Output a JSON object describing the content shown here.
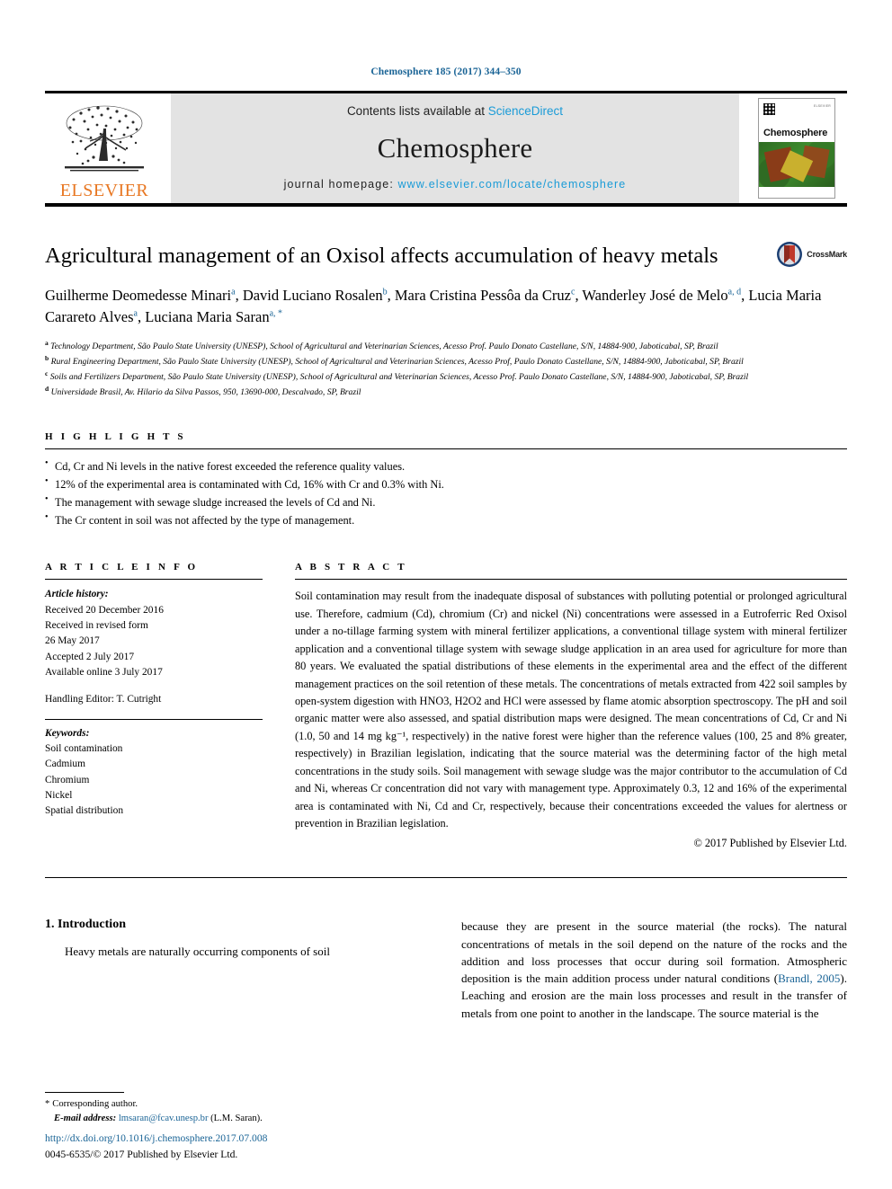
{
  "running_head": "Chemosphere 185 (2017) 344–350",
  "masthead": {
    "publisher_name": "ELSEVIER",
    "contents_prefix": "Contents lists available at ",
    "contents_link": "ScienceDirect",
    "journal_name": "Chemosphere",
    "homepage_prefix": "journal homepage: ",
    "homepage_url": "www.elsevier.com/locate/chemosphere",
    "cover_title": "Chemosphere",
    "cover_publisher": "ELSEVIER"
  },
  "article": {
    "title": "Agricultural management of an Oxisol affects accumulation of heavy metals",
    "crossmark_label": "CrossMark",
    "authors_line1": "Guilherme Deomedesse Minari",
    "authors": "Guilherme Deomedesse Minari a, David Luciano Rosalen b, Mara Cristina Pessôa da Cruz c, Wanderley José de Melo a, d, Lucia Maria Carareto Alves a, Luciana Maria Saran a, *",
    "affiliations": [
      "Technology Department, São Paulo State University (UNESP), School of Agricultural and Veterinarian Sciences, Acesso Prof. Paulo Donato Castellane, S/N, 14884-900, Jaboticabal, SP, Brazil",
      "Rural Engineering Department, São Paulo State University (UNESP), School of Agricultural and Veterinarian Sciences, Acesso Prof, Paulo Donato Castellane, S/N, 14884-900, Jaboticabal, SP, Brazil",
      "Soils and Fertilizers Department, São Paulo State University (UNESP), School of Agricultural and Veterinarian Sciences, Acesso Prof. Paulo Donato Castellane, S/N, 14884-900, Jaboticabal, SP, Brazil",
      "Universidade Brasil, Av. Hilario da Silva Passos, 950, 13690-000, Descalvado, SP, Brazil"
    ],
    "affiliation_marks": [
      "a",
      "b",
      "c",
      "d"
    ]
  },
  "highlights": {
    "heading": "H I G H L I G H T S",
    "items": [
      "Cd, Cr and Ni levels in the native forest exceeded the reference quality values.",
      "12% of the experimental area is contaminated with Cd, 16% with Cr and 0.3% with Ni.",
      "The management with sewage sludge increased the levels of Cd and Ni.",
      "The Cr content in soil was not affected by the type of management."
    ]
  },
  "article_info": {
    "heading": "A R T I C L E   I N F O",
    "history_label": "Article history:",
    "history": [
      "Received 20 December 2016",
      "Received in revised form",
      "26 May 2017",
      "Accepted 2 July 2017",
      "Available online 3 July 2017"
    ],
    "handling_editor": "Handling Editor: T. Cutright",
    "keywords_label": "Keywords:",
    "keywords": [
      "Soil contamination",
      "Cadmium",
      "Chromium",
      "Nickel",
      "Spatial distribution"
    ]
  },
  "abstract": {
    "heading": "A B S T R A C T",
    "text": "Soil contamination may result from the inadequate disposal of substances with polluting potential or prolonged agricultural use. Therefore, cadmium (Cd), chromium (Cr) and nickel (Ni) concentrations were assessed in a Eutroferric Red Oxisol under a no-tillage farming system with mineral fertilizer applications, a conventional tillage system with mineral fertilizer application and a conventional tillage system with sewage sludge application in an area used for agriculture for more than 80 years. We evaluated the spatial distributions of these elements in the experimental area and the effect of the different management practices on the soil retention of these metals. The concentrations of metals extracted from 422 soil samples by open-system digestion with HNO3, H2O2 and HCl were assessed by flame atomic absorption spectroscopy. The pH and soil organic matter were also assessed, and spatial distribution maps were designed. The mean concentrations of Cd, Cr and Ni (1.0, 50 and 14 mg kg⁻¹, respectively) in the native forest were higher than the reference values (100, 25 and 8% greater, respectively) in Brazilian legislation, indicating that the source material was the determining factor of the high metal concentrations in the study soils. Soil management with sewage sludge was the major contributor to the accumulation of Cd and Ni, whereas Cr concentration did not vary with management type. Approximately 0.3, 12 and 16% of the experimental area is contaminated with Ni, Cd and Cr, respectively, because their concentrations exceeded the values for alertness or prevention in Brazilian legislation.",
    "copyright": "© 2017 Published by Elsevier Ltd."
  },
  "body": {
    "section_number_title": "1. Introduction",
    "left_paragraph": "Heavy metals are naturally occurring components of soil",
    "right_paragraph_part1": "because they are present in the source material (the rocks). The natural concentrations of metals in the soil depend on the nature of the rocks and the addition and loss processes that occur during soil formation. Atmospheric deposition is the main addition process under natural conditions (",
    "right_citation": "Brandl, 2005",
    "right_paragraph_part2": "). Leaching and erosion are the main loss processes and result in the transfer of metals from one point to another in the landscape. The source material is the"
  },
  "footer": {
    "corresponding_marker": "*",
    "corresponding_text": "Corresponding author.",
    "email_label": "E-mail address:",
    "email": "lmsaran@fcav.unesp.br",
    "email_owner": "(L.M. Saran).",
    "doi_url": "http://dx.doi.org/10.1016/j.chemosphere.2017.07.008",
    "issn_line": "0045-6535/© 2017 Published by Elsevier Ltd."
  },
  "colors": {
    "link_blue": "#1a6496",
    "sciencedirect_blue": "#1a9bd7",
    "elsevier_orange": "#E87722",
    "masthead_gray": "#e3e3e3"
  }
}
